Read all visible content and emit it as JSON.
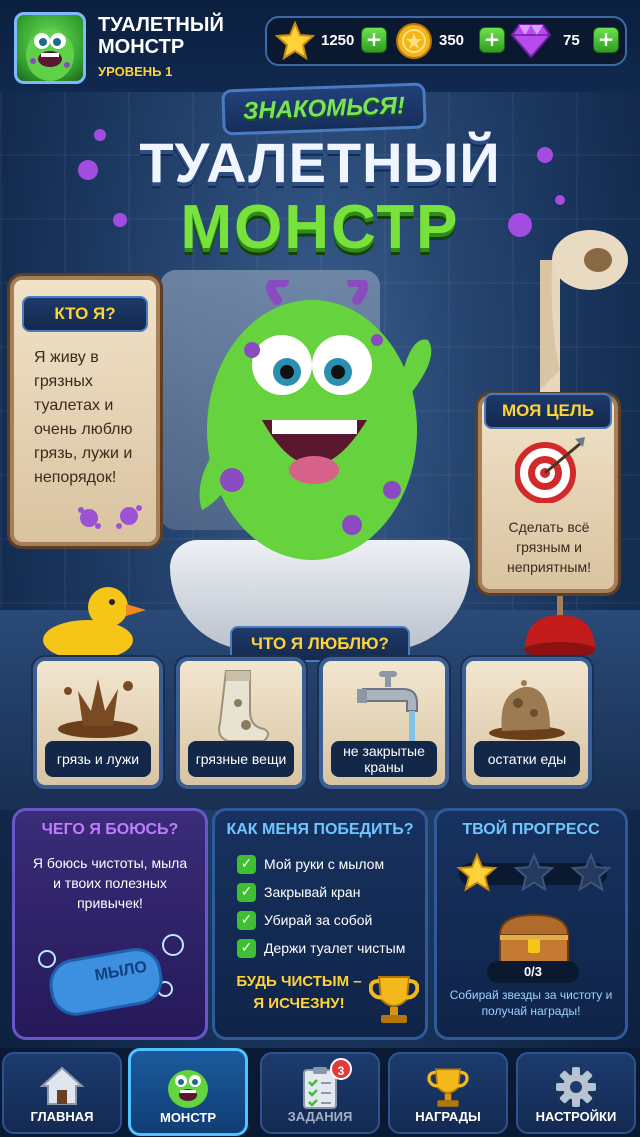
{
  "header": {
    "title": "ТУАЛЕТНЫЙ МОНСТР",
    "level": "УРОВЕНЬ 1",
    "currencies": [
      {
        "icon": "star-icon",
        "amount": "1250",
        "plus": "+"
      },
      {
        "icon": "coin-icon",
        "amount": "350",
        "plus": "+"
      },
      {
        "icon": "gem-icon",
        "amount": "75",
        "plus": "+"
      }
    ]
  },
  "headline": {
    "small": "ЗНАКОМЬСЯ!",
    "line1": "ТУАЛЕТНЫЙ",
    "line2": "МОНСТР"
  },
  "who_am_i": {
    "title": "КТО Я?",
    "text": "Я живу в грязных туалетах и очень люблю грязь, лужи и непорядок!"
  },
  "my_goal": {
    "title": "МОЯ ЦЕЛЬ",
    "text": "Сделать всё грязным и неприятным!"
  },
  "likes": {
    "title": "ЧТО Я ЛЮБЛЮ?",
    "items": [
      {
        "label": "грязь и лужи",
        "icon": "mud-splash-icon"
      },
      {
        "label": "грязные вещи",
        "icon": "dirty-sock-icon"
      },
      {
        "label": "не закрытые краны",
        "icon": "faucet-icon"
      },
      {
        "label": "остатки еды",
        "icon": "food-leftovers-icon"
      }
    ]
  },
  "fears": {
    "title": "ЧЕГО Я БОЮСЬ?",
    "text": "Я боюсь чистоты, мыла и твоих полезных привычек!",
    "soap_label": "МЫЛО"
  },
  "defeat": {
    "title": "КАК МЕНЯ ПОБЕДИТЬ?",
    "items": [
      "Мой руки с мылом",
      "Закрывай кран",
      "Убирай за собой",
      "Держи туалет чистым"
    ],
    "footer": "БУДЬ ЧИСТЫМ – Я ИСЧЕЗНУ!"
  },
  "progress": {
    "title": "ТВОЙ ПРОГРЕСС",
    "stars_filled": 1,
    "stars_total": 3,
    "count": "0/3",
    "text": "Собирай звезды за чистоту и получай награды!"
  },
  "nav": {
    "items": [
      {
        "label": "ГЛАВНАЯ",
        "icon": "home-icon"
      },
      {
        "label": "МОНСТР",
        "icon": "monster-icon"
      },
      {
        "label": "ЗАДАНИЯ",
        "icon": "tasks-icon",
        "badge": "3"
      },
      {
        "label": "НАГРАДЫ",
        "icon": "trophy-icon"
      },
      {
        "label": "НАСТРОЙКИ",
        "icon": "gear-icon"
      }
    ],
    "active": "МОНСТР"
  },
  "colors": {
    "accent_yellow": "#ffd23a",
    "monster_green": "#78e23d",
    "fear_purple": "#c07bff",
    "defeat_blue": "#6fc6ff"
  }
}
